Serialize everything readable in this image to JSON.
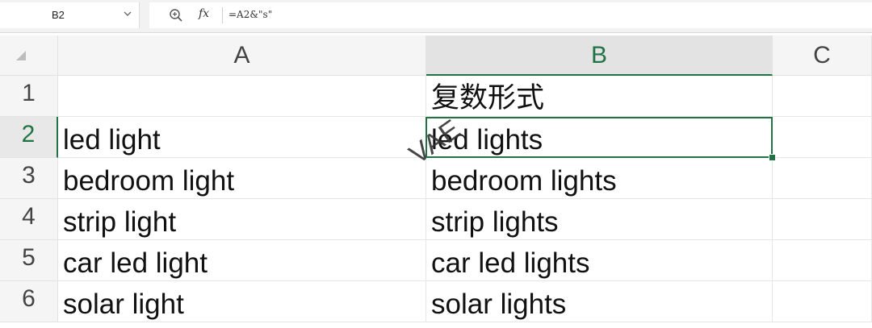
{
  "formula_bar": {
    "name_box": "B2",
    "formula": "=A2&\"s\"",
    "fx_label": "fx"
  },
  "columns": [
    "A",
    "B",
    "C"
  ],
  "selected_column": "B",
  "rows": [
    {
      "num": "1",
      "a": "",
      "b": "复数形式"
    },
    {
      "num": "2",
      "a": "led light",
      "b": "led lights"
    },
    {
      "num": "3",
      "a": "bedroom light",
      "b": "bedroom lights"
    },
    {
      "num": "4",
      "a": "strip light",
      "b": "strip lights"
    },
    {
      "num": "5",
      "a": "car led light",
      "b": "car led lights"
    },
    {
      "num": "6",
      "a": "solar light",
      "b": "solar lights"
    }
  ],
  "active_cell": "B2",
  "watermark": "VAE",
  "colors": {
    "accent": "#217346"
  },
  "icons": {
    "zoom": "zoom-formula-icon",
    "dropdown": "chevron-down-icon",
    "corner": "select-all-icon"
  }
}
